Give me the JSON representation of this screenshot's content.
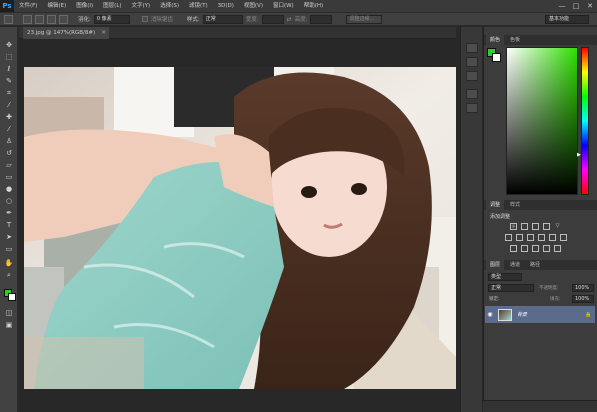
{
  "app": {
    "logo": "Ps"
  },
  "menu": [
    "文件(F)",
    "编辑(E)",
    "图像(I)",
    "图层(L)",
    "文字(Y)",
    "选择(S)",
    "滤镜(T)",
    "3D(D)",
    "视图(V)",
    "窗口(W)",
    "帮助(H)"
  ],
  "window_controls": {
    "minimize": "—",
    "maximize": "□",
    "close": "✕"
  },
  "options": {
    "feather_label": "羽化:",
    "feather_value": "0 像素",
    "antialias_label": "消除锯齿",
    "style_label": "样式:",
    "style_value": "正常",
    "width_label": "宽度:",
    "height_label": "高度:",
    "refine_button": "调整边缘..."
  },
  "workspace": "基本功能",
  "document": {
    "tab_title": "23.jpg @ 147%(RGB/8#)",
    "close": "×"
  },
  "color_panel": {
    "tabs": [
      "颜色",
      "色板"
    ],
    "fg_color": "#2ecc2e",
    "bg_color": "#ffffff"
  },
  "adjust_panel": {
    "tabs": [
      "调整",
      "样式"
    ],
    "title": "添加调整"
  },
  "layers_panel": {
    "tabs": [
      "图层",
      "通道",
      "路径"
    ],
    "kind_label": "类型",
    "blend_mode": "正常",
    "opacity_label": "不透明度:",
    "opacity_value": "100%",
    "lock_label": "锁定:",
    "fill_label": "填充:",
    "fill_value": "100%",
    "layer_name": "背景"
  },
  "icons": [
    "move-icon",
    "marquee-icon",
    "lasso-icon",
    "quick-select-icon",
    "crop-icon",
    "eyedropper-icon",
    "healing-icon",
    "brush-icon",
    "stamp-icon",
    "history-brush-icon",
    "eraser-icon",
    "gradient-icon",
    "blur-icon",
    "dodge-icon",
    "pen-icon",
    "type-icon",
    "path-select-icon",
    "shape-icon",
    "hand-icon",
    "zoom-icon"
  ]
}
